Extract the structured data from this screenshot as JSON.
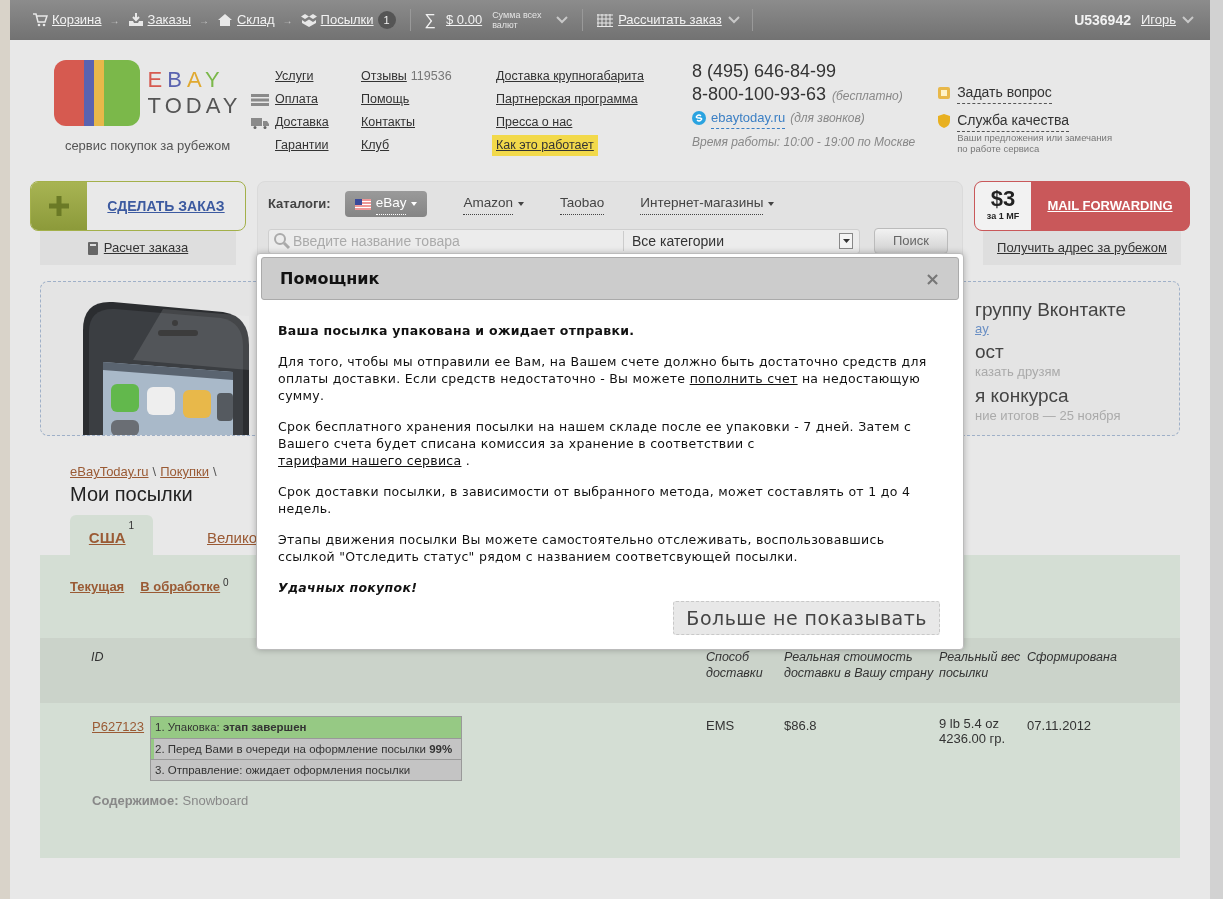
{
  "top_bar": {
    "steps": [
      {
        "label": "Корзина",
        "kind": "cart"
      },
      {
        "label": "Заказы",
        "kind": "orders"
      },
      {
        "label": "Склад",
        "kind": "warehouse"
      },
      {
        "label": "Посылки",
        "kind": "parcels",
        "badge": "1"
      }
    ],
    "balance": {
      "symbol": "∑",
      "amount": "$ 0.00",
      "caption": "Сумма всех валют"
    },
    "separator": "→",
    "calculate": "Рассчитать заказ",
    "user_id": "U536942",
    "user_name": "Игорь"
  },
  "header": {
    "logo": {
      "brand_top": "EBAY",
      "brand_bottom": "TODAY",
      "tagline": "сервис покупок за рубежом"
    },
    "nav_columns": [
      [
        {
          "label": "Услуги",
          "kind": "plain",
          "highlighted": false
        },
        {
          "label": "Оплата",
          "kind": "payment",
          "highlighted": false
        },
        {
          "label": "Доставка",
          "kind": "delivery",
          "highlighted": false
        },
        {
          "label": "Гарантии",
          "kind": "plain",
          "highlighted": false
        }
      ],
      [
        {
          "label": "Отзывы",
          "count": "119536",
          "highlighted": false
        },
        {
          "label": "Помощь",
          "highlighted": false
        },
        {
          "label": "Контакты",
          "highlighted": false
        },
        {
          "label": "Клуб",
          "highlighted": false
        }
      ],
      [
        {
          "label": "Доставка крупногабарита",
          "highlighted": false
        },
        {
          "label": "Партнерская программа",
          "highlighted": false
        },
        {
          "label": "Пресса о нас",
          "highlighted": false
        },
        {
          "label": "Как это работает",
          "highlighted": true
        }
      ]
    ],
    "contacts": {
      "phone": "8 (495) 646-84-99",
      "free_phone": "8-800-100-93-63",
      "free_note": "(бесплатно)",
      "skype": "ebaytoday.ru",
      "skype_note": "(для звонков)",
      "hours": "Время работы: 10:00 - 19:00 по Москве"
    },
    "support": {
      "ask": "Задать вопрос",
      "quality": "Служба качества",
      "quality_note": "Ваши предложения или замечания по работе сервиса"
    }
  },
  "order": {
    "button": "СДЕЛАТЬ ЗАКАЗ",
    "calc_link": "Расчет заказа"
  },
  "catalogs": {
    "label": "Каталоги:",
    "stores": [
      {
        "label": "eBay",
        "selected": true,
        "dropdown": true
      },
      {
        "label": "Amazon",
        "selected": false,
        "dropdown": true
      },
      {
        "label": "Taobao",
        "selected": false,
        "dropdown": false
      },
      {
        "label": "Интернет-магазины",
        "selected": false,
        "dropdown": true
      }
    ],
    "search": {
      "placeholder": "Введите название товара",
      "category": "Все категории",
      "button": "Поиск"
    }
  },
  "mail_forwarding": {
    "price": "$3",
    "unit": "за 1 MF",
    "label": "MAIL FORWARDING",
    "link": "Получить адрес за рубежом"
  },
  "banner": {
    "lines": [
      {
        "text": "группу Вконтакте",
        "kind": "title"
      },
      {
        "text": "ay",
        "kind": "link"
      },
      {
        "text": "ост",
        "kind": "title"
      },
      {
        "text": "казать друзям",
        "kind": "note"
      },
      {
        "text": "я конкурса",
        "kind": "title"
      },
      {
        "text": "ние итогов — 25 ноября",
        "kind": "note"
      }
    ]
  },
  "breadcrumb": {
    "items": [
      "eBayToday.ru",
      "Покупки"
    ],
    "separator": "\\"
  },
  "title": "Мои посылки",
  "tabs": [
    {
      "label": "США",
      "count": "1",
      "selected": true
    },
    {
      "label": "Велико",
      "selected": false
    }
  ],
  "subtabs": [
    {
      "label": "Текущая"
    },
    {
      "label": "В обработке",
      "count": "0"
    }
  ],
  "table": {
    "columns": [
      "ID",
      "Способ доставки",
      "Реальная стоимость доставки в Вашу страну",
      "Реальный вес посылки",
      "Сформирована"
    ],
    "rows": [
      {
        "id": "P627123",
        "stages": [
          {
            "text": "1. Упаковка: **этап завершен**",
            "level": 1
          },
          {
            "text": "2. Перед Вами в очереди на оформление посылки **99%**",
            "level": 0.01
          },
          {
            "text": "3. Отправление: ожидает оформления посылки",
            "level": 0
          }
        ],
        "contents_label": "Содержимое:",
        "contents": "Snowboard",
        "method": "EMS",
        "cost": "$86.8",
        "weight": [
          "9 lb 5.4 oz",
          "4236.00 гр."
        ],
        "date": "07.11.2012"
      }
    ]
  },
  "dialog": {
    "title": "Помощник",
    "close": "×",
    "paragraphs": [
      {
        "kind": "lead",
        "parts": [
          {
            "text": "Ваша посылка упакована и ожидает отправки."
          }
        ]
      },
      {
        "kind": "body",
        "parts": [
          {
            "text": "Для того, чтобы мы отправили ее Вам, на Вашем счете должно быть достаточно средств для оплаты доставки. Если средств недостаточно - Вы можете "
          },
          {
            "text": "пополнить счет",
            "kind": "link"
          },
          {
            "text": " на недостающую сумму."
          }
        ]
      },
      {
        "kind": "body",
        "parts": [
          {
            "text": "Срок бесплатного хранения посылки на нашем складе после ее упаковки - 7 дней. Затем с Вашего счета будет списана комиссия за хранение в соответствии с "
          },
          {
            "text": "тарифами нашего сервиса",
            "kind": "link"
          },
          {
            "text": " ."
          }
        ]
      },
      {
        "kind": "body",
        "parts": [
          {
            "text": "Срок доставки посылки, в зависимости от выбранного метода, может составлять от 1 до 4 недель."
          }
        ]
      },
      {
        "kind": "body",
        "parts": [
          {
            "text": "Этапы движения посылки Вы можете самостоятельно отслеживать, воспользовавшись ссылкой \"Отследить статус\" рядом с названием соответсвующей посылки."
          }
        ]
      },
      {
        "kind": "closing",
        "parts": [
          {
            "text": "Удачных покупок!"
          }
        ]
      }
    ],
    "button": "Больше не показывать"
  }
}
